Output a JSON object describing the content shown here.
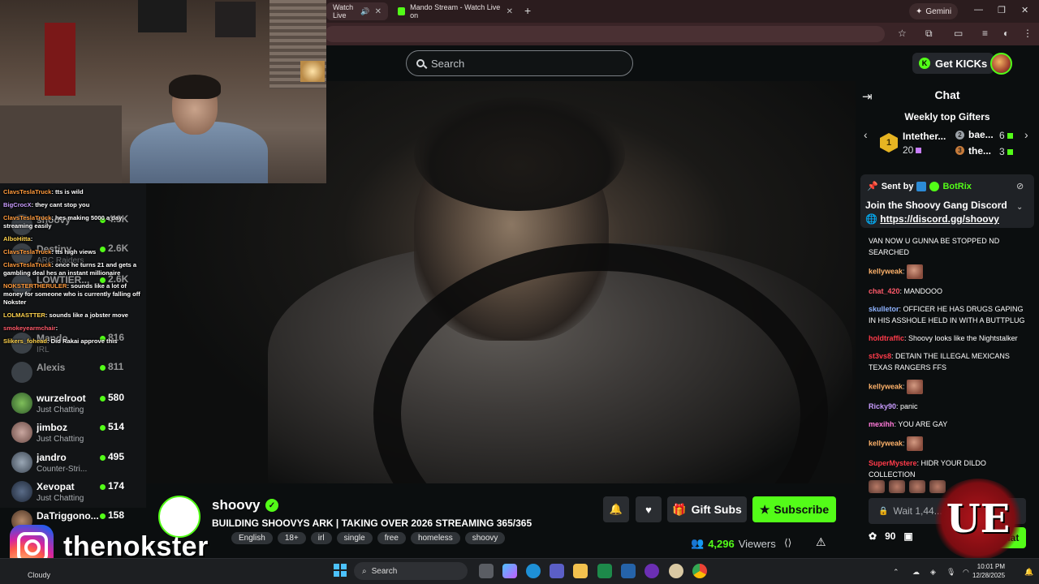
{
  "browser": {
    "tabs": [
      {
        "label": "Watch Live"
      },
      {
        "label": "Mando Stream - Watch Live on"
      }
    ],
    "gemini_label": "Gemini"
  },
  "header": {
    "search_placeholder": "Search",
    "get_kicks_label": "Get KICKs"
  },
  "sidebar": {
    "items": [
      {
        "name": "shoovy",
        "category": "",
        "viewers": "4.3K"
      },
      {
        "name": "Destiny",
        "category": "ARC Raiders",
        "viewers": "2.6K"
      },
      {
        "name": "LOWTIER...",
        "category": "",
        "viewers": "2.6K"
      },
      {
        "name": "Mando",
        "category": "IRL",
        "viewers": "816"
      },
      {
        "name": "Alexis",
        "category": "",
        "viewers": "811"
      },
      {
        "name": "wurzelroot",
        "category": "Just Chatting",
        "viewers": "580"
      },
      {
        "name": "jimboz",
        "category": "Just Chatting",
        "viewers": "514"
      },
      {
        "name": "jandro",
        "category": "Counter-Stri...",
        "viewers": "495"
      },
      {
        "name": "Xevopat",
        "category": "Just Chatting",
        "viewers": "174"
      },
      {
        "name": "DaTriggono...",
        "category": "",
        "viewers": "158"
      }
    ]
  },
  "overlay_chat": [
    {
      "user": "ClavsTeslaTruck",
      "color": "#ff9a3c",
      "text": ": tts is wild"
    },
    {
      "user": "BigCrocX",
      "color": "#c99cff",
      "text": ": they cant stop you"
    },
    {
      "user": "ClavsTeslaTruck",
      "color": "#ff9a3c",
      "text": ": hes making 5000 a day streaming easily"
    },
    {
      "user": "AlboHitta",
      "color": "#ffd34d",
      "text": ":"
    },
    {
      "user": "ClavsTeslaTruck",
      "color": "#ff9a3c",
      "text": ": tts high views"
    },
    {
      "user": "ClavsTeslaTruck",
      "color": "#ff9a3c",
      "text": ": once he turns 21 and gets a gambling deal hes an instant millionaire"
    },
    {
      "user": "NOKSTERTHERULER",
      "color": "#ff9a3c",
      "text": ": sounds like a lot of money for someone who is currently falling off Nokster"
    },
    {
      "user": "LOLMASTTER",
      "color": "#ffd34d",
      "text": ": sounds like a jobster move"
    },
    {
      "user": "smokeyearmchair",
      "color": "#ff5a6a",
      "text": ":"
    },
    {
      "user": "Slikers_fohead",
      "color": "#ffd34d",
      "text": ": Did Rakai approve this"
    }
  ],
  "stream": {
    "channel": "shoovy",
    "title": "BUILDING SHOOVYS ARK | TAKING OVER 2026 STREAMING 365/365",
    "tags": [
      "English",
      "18+",
      "irl",
      "single",
      "free",
      "homeless",
      "shoovy"
    ],
    "viewers": "4,296",
    "viewers_label": "Viewers",
    "gift_label": "Gift Subs",
    "subscribe_label": "Subscribe"
  },
  "chat": {
    "title": "Chat",
    "weekly_title": "Weekly top Gifters",
    "gifters": [
      {
        "rank": "1",
        "name": "Intether...",
        "count": "20"
      },
      {
        "rank": "2",
        "name": "bae...",
        "count": "6"
      },
      {
        "rank": "3",
        "name": "the...",
        "count": "3"
      }
    ],
    "pinned": {
      "sent_by": "Sent by",
      "bot": "BotRix",
      "text": "Join the Shoovy Gang Discord",
      "link": "https://discord.gg/shoovy"
    },
    "messages": [
      {
        "user": "",
        "color": "#ffffff",
        "text": "VAN NOW U GUNNA BE STOPPED ND SEARCHED",
        "emote": false
      },
      {
        "user": "kellyweak",
        "color": "#ffb36b",
        "text": ":",
        "emote": true
      },
      {
        "user": "chat_420",
        "color": "#ff5a6a",
        "text": ": MANDOOO",
        "emote": false
      },
      {
        "user": "skulletor",
        "color": "#8fb3ff",
        "text": ": OFFICER HE HAS DRUGS GAPING IN HIS ASSHOLE HELD IN WITH A BUTTPLUG",
        "emote": false
      },
      {
        "user": "holdtraffic",
        "color": "#ff3b4a",
        "text": ": Shoovy looks like the Nightstalker",
        "emote": false
      },
      {
        "user": "st3vs8",
        "color": "#ff3b4a",
        "text": ": DETAIN THE ILLEGAL MEXICANS TEXAS RANGERS FFS",
        "emote": false
      },
      {
        "user": "kellyweak",
        "color": "#ffb36b",
        "text": ":",
        "emote": true
      },
      {
        "user": "Ricky90",
        "color": "#c99cff",
        "text": ": panic",
        "emote": false
      },
      {
        "user": "mexihh",
        "color": "#ff7ad9",
        "text": ": YOU ARE GAY",
        "emote": false
      },
      {
        "user": "kellyweak",
        "color": "#ffb36b",
        "text": ":",
        "emote": true
      },
      {
        "user": "SuperMystere",
        "color": "#ff3b4a",
        "text": ": HIDR YOUR DILDO COLLECTION",
        "emote": false
      }
    ],
    "input_placeholder": "Wait 1,44... following",
    "points": "90",
    "send_label": "Chat"
  },
  "overlay": {
    "instagram_handle": "thenokster",
    "badge_text": "UE"
  },
  "taskbar": {
    "weather": "Cloudy",
    "search_label": "Search",
    "time": "10:01 PM",
    "date": "12/28/2025"
  }
}
